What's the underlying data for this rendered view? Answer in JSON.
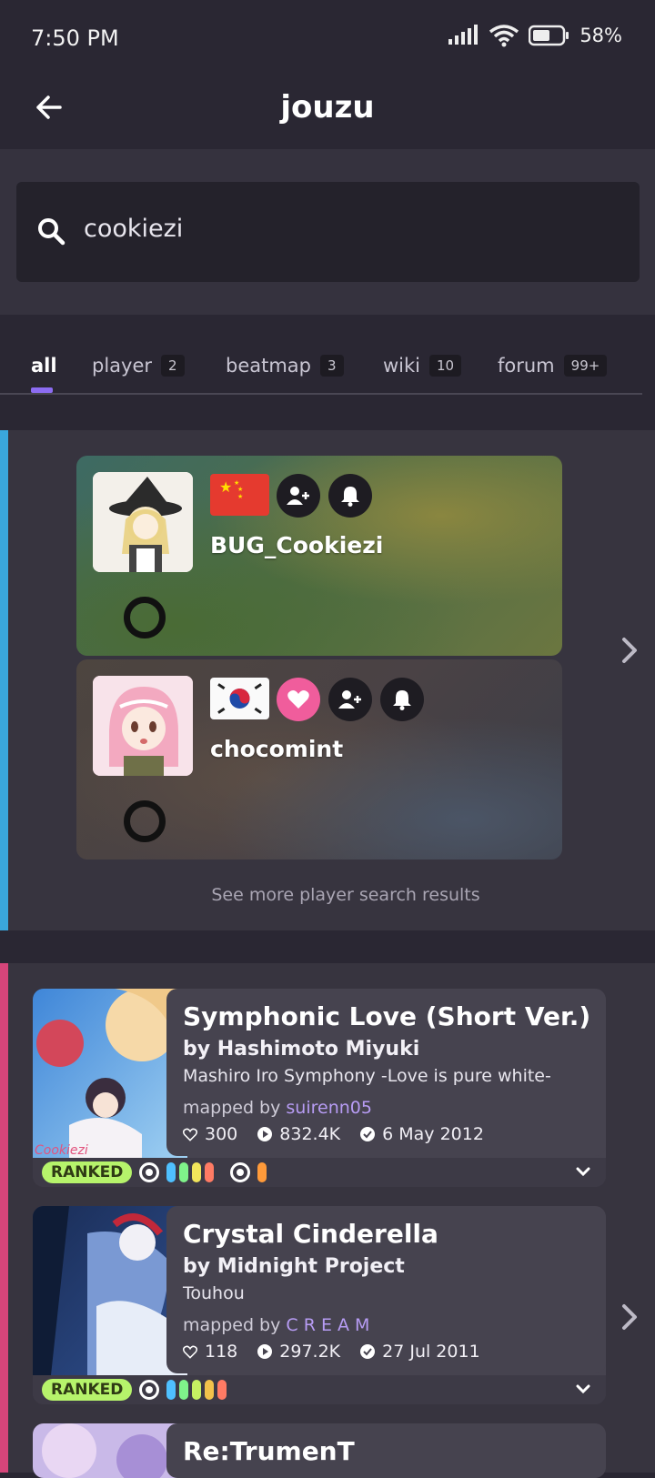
{
  "status": {
    "time": "7:50 PM",
    "battery": "58%"
  },
  "appbar": {
    "title": "jouzu"
  },
  "search": {
    "value": "cookiezi"
  },
  "tabs": [
    {
      "label": "all",
      "count": ""
    },
    {
      "label": "player",
      "count": "2"
    },
    {
      "label": "beatmap",
      "count": "3"
    },
    {
      "label": "wiki",
      "count": "10"
    },
    {
      "label": "forum",
      "count": "99+"
    }
  ],
  "players": {
    "accent": "#3aa7dc",
    "items": [
      {
        "name": "BUG_Cookiezi",
        "flag": "cn"
      },
      {
        "name": "chocomint",
        "flag": "kr"
      }
    ],
    "see_more": "See more player search results"
  },
  "beatmaps": {
    "accent": "#d6457a",
    "items": [
      {
        "title": "Symphonic Love (Short Ver.)",
        "artist": "by Hashimoto Miyuki",
        "source": "Mashiro Iro Symphony -Love is pure white-",
        "mapped_by": "mapped by ",
        "mapper": "suirenn05",
        "favourites": "300",
        "plays": "832.4K",
        "date": "6 May 2012",
        "status": "RANKED"
      },
      {
        "title": "Crystal Cinderella",
        "artist": "by Midnight Project",
        "source": "Touhou",
        "mapped_by": "mapped by ",
        "mapper": "C R E A M",
        "favourites": "118",
        "plays": "297.2K",
        "date": "27 Jul 2011",
        "status": "RANKED"
      },
      {
        "title": "Re:TrumenT"
      }
    ]
  }
}
